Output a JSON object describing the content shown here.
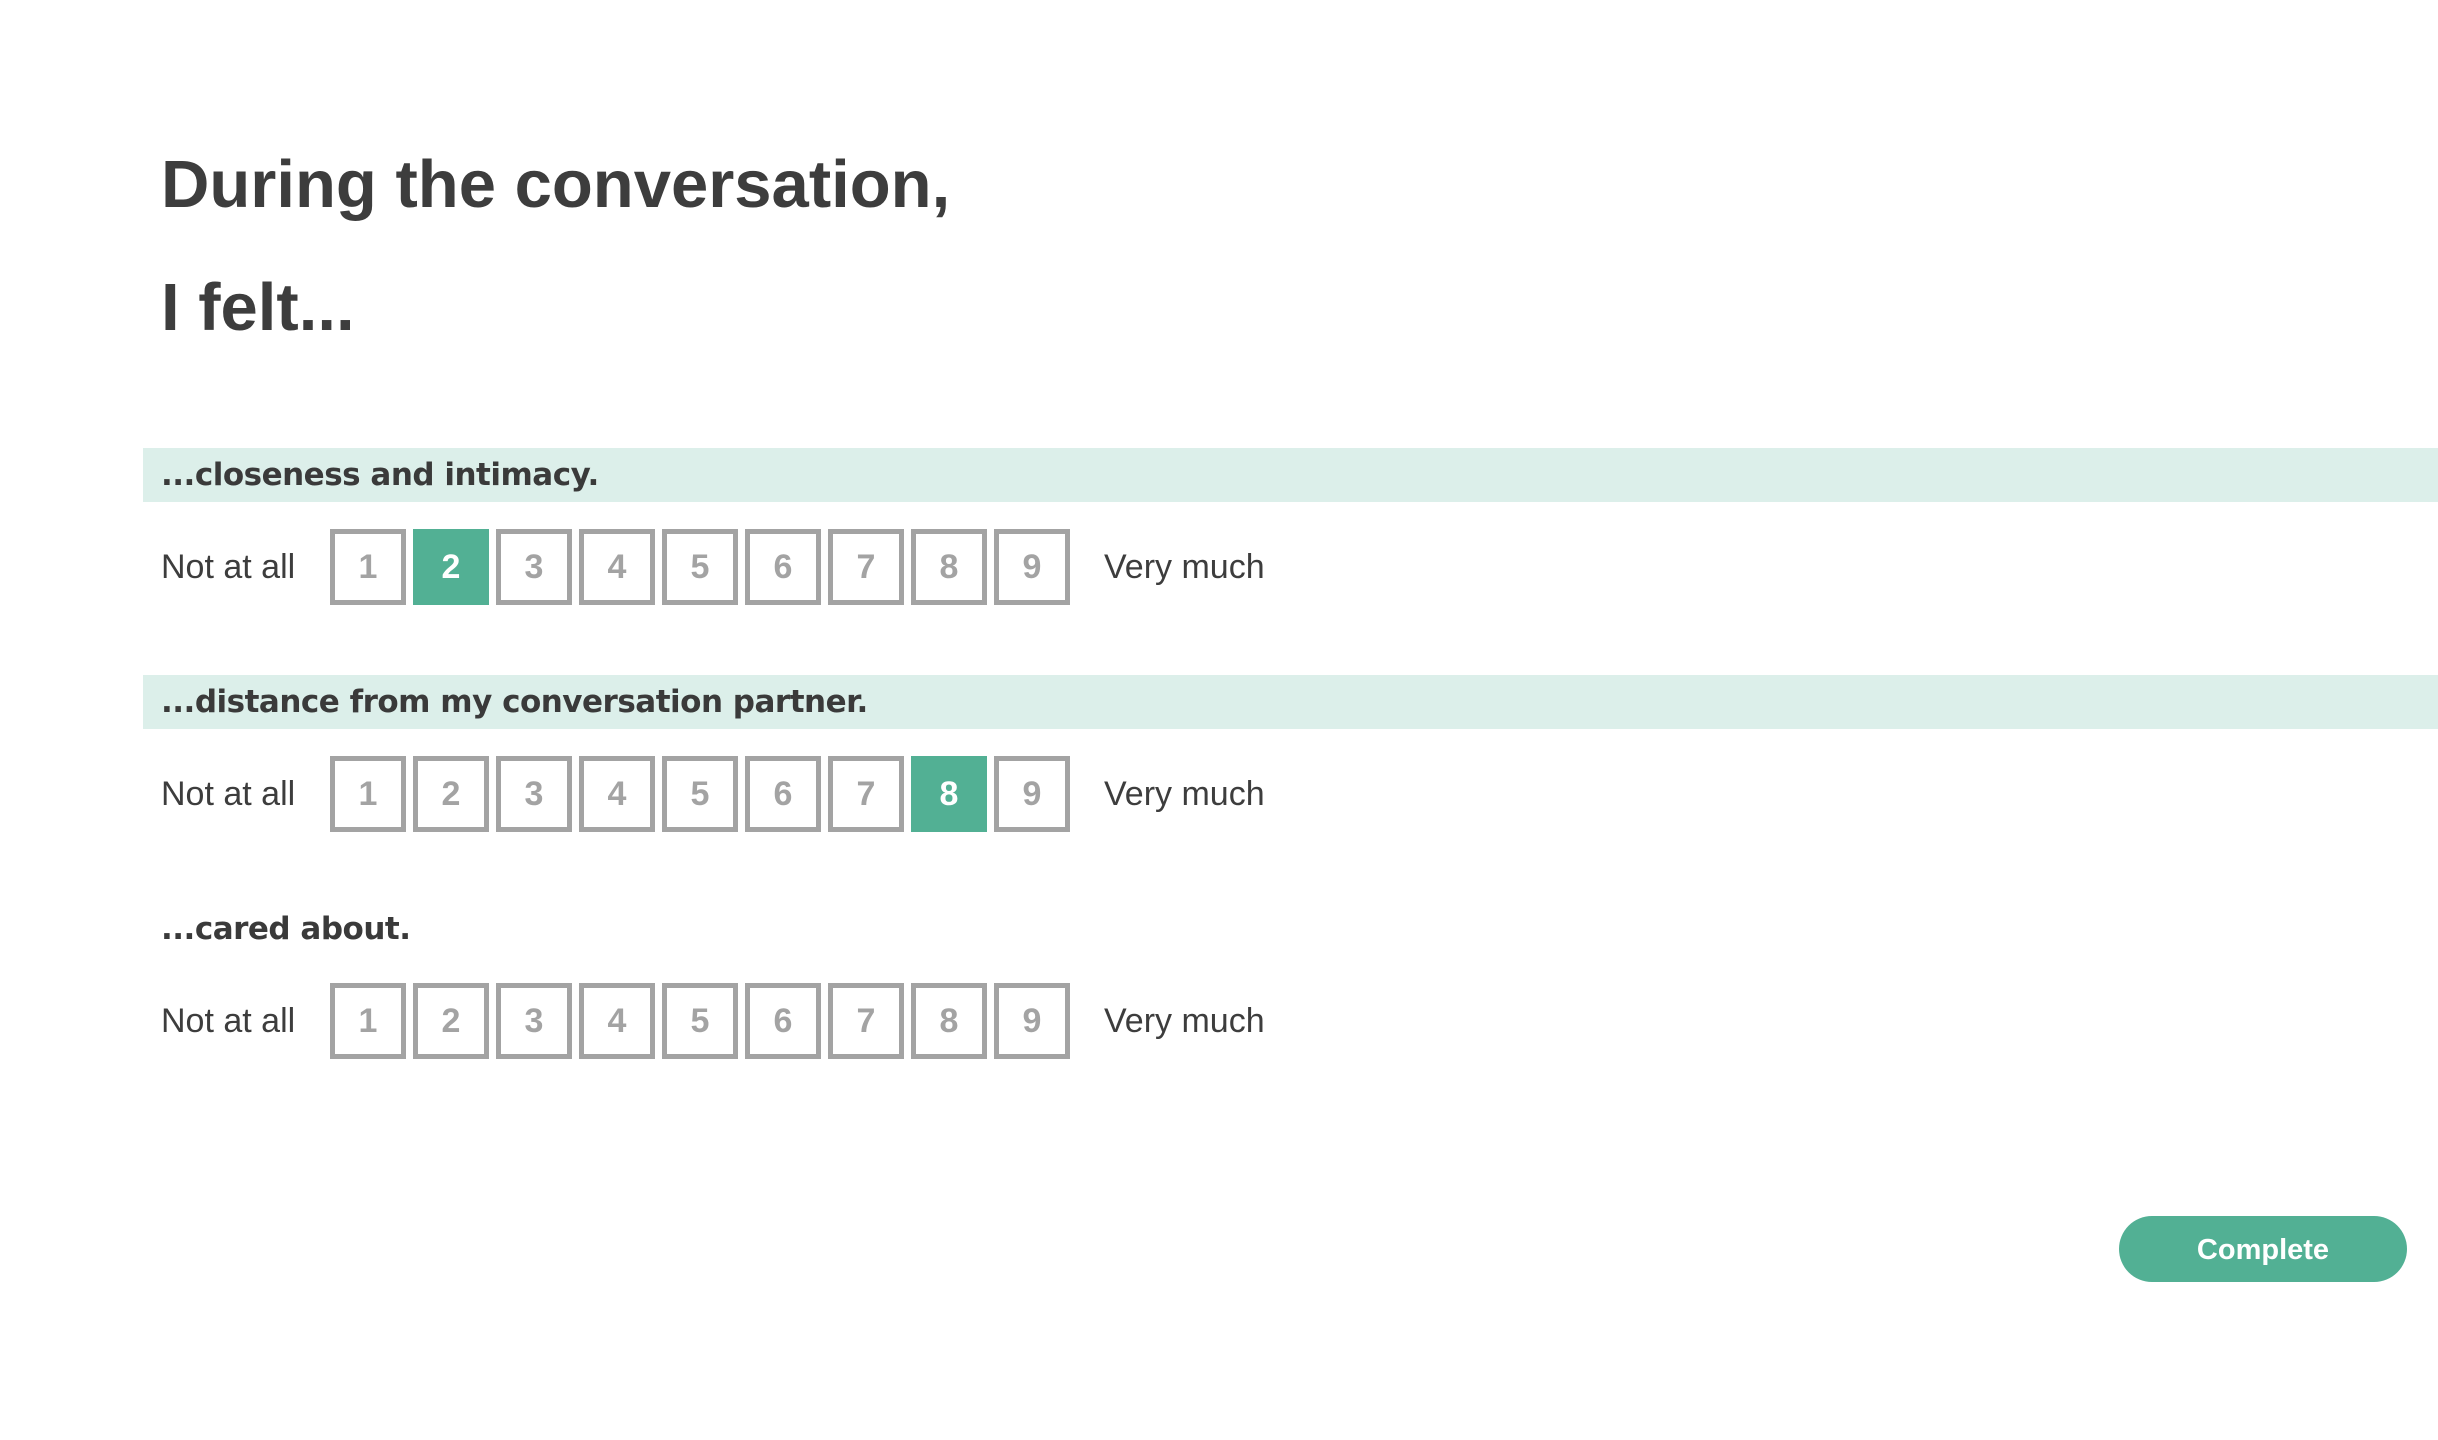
{
  "heading": {
    "line1": "During the conversation,",
    "line2": "I felt..."
  },
  "colors": {
    "accent": "#52b094",
    "row_highlight": "#dcefea",
    "option_border": "#a3a3a3",
    "text": "#3d3d3d"
  },
  "questions": [
    {
      "text": "...closeness and intimacy.",
      "highlighted": true,
      "low_label": "Not at all",
      "high_label": "Very much",
      "options": [
        "1",
        "2",
        "3",
        "4",
        "5",
        "6",
        "7",
        "8",
        "9"
      ],
      "selected": "2"
    },
    {
      "text": "...distance from my conversation partner.",
      "highlighted": true,
      "low_label": "Not at all",
      "high_label": "Very much",
      "options": [
        "1",
        "2",
        "3",
        "4",
        "5",
        "6",
        "7",
        "8",
        "9"
      ],
      "selected": "8"
    },
    {
      "text": "...cared about.",
      "highlighted": false,
      "low_label": "Not at all",
      "high_label": "Very much",
      "options": [
        "1",
        "2",
        "3",
        "4",
        "5",
        "6",
        "7",
        "8",
        "9"
      ],
      "selected": null
    }
  ],
  "complete_button": {
    "label": "Complete"
  }
}
